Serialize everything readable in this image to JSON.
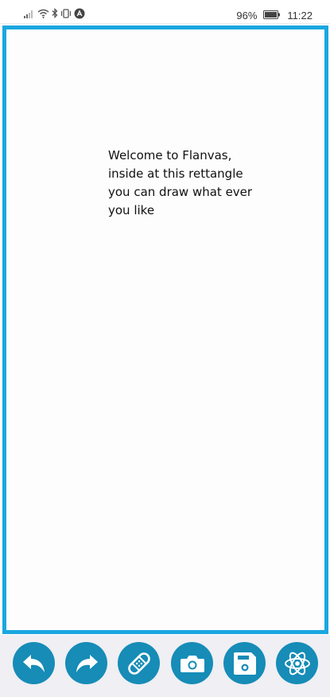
{
  "status_bar": {
    "battery_percent": "96%",
    "time": "11:22",
    "icons": [
      "signal-icon",
      "wifi-icon",
      "bluetooth-icon",
      "vibrate-icon",
      "app-notification-icon",
      "battery-icon"
    ]
  },
  "canvas": {
    "border_color": "#1aa7e0",
    "welcome_lines": [
      "Welcome to Flanvas,",
      "inside at this rettangle",
      "you can draw what ever",
      "you like"
    ]
  },
  "toolbar": {
    "button_color": "#168cb7",
    "buttons": [
      {
        "icon": "undo-icon"
      },
      {
        "icon": "redo-icon"
      },
      {
        "icon": "bandage-icon"
      },
      {
        "icon": "camera-icon"
      },
      {
        "icon": "save-icon"
      },
      {
        "icon": "atom-icon"
      }
    ]
  }
}
